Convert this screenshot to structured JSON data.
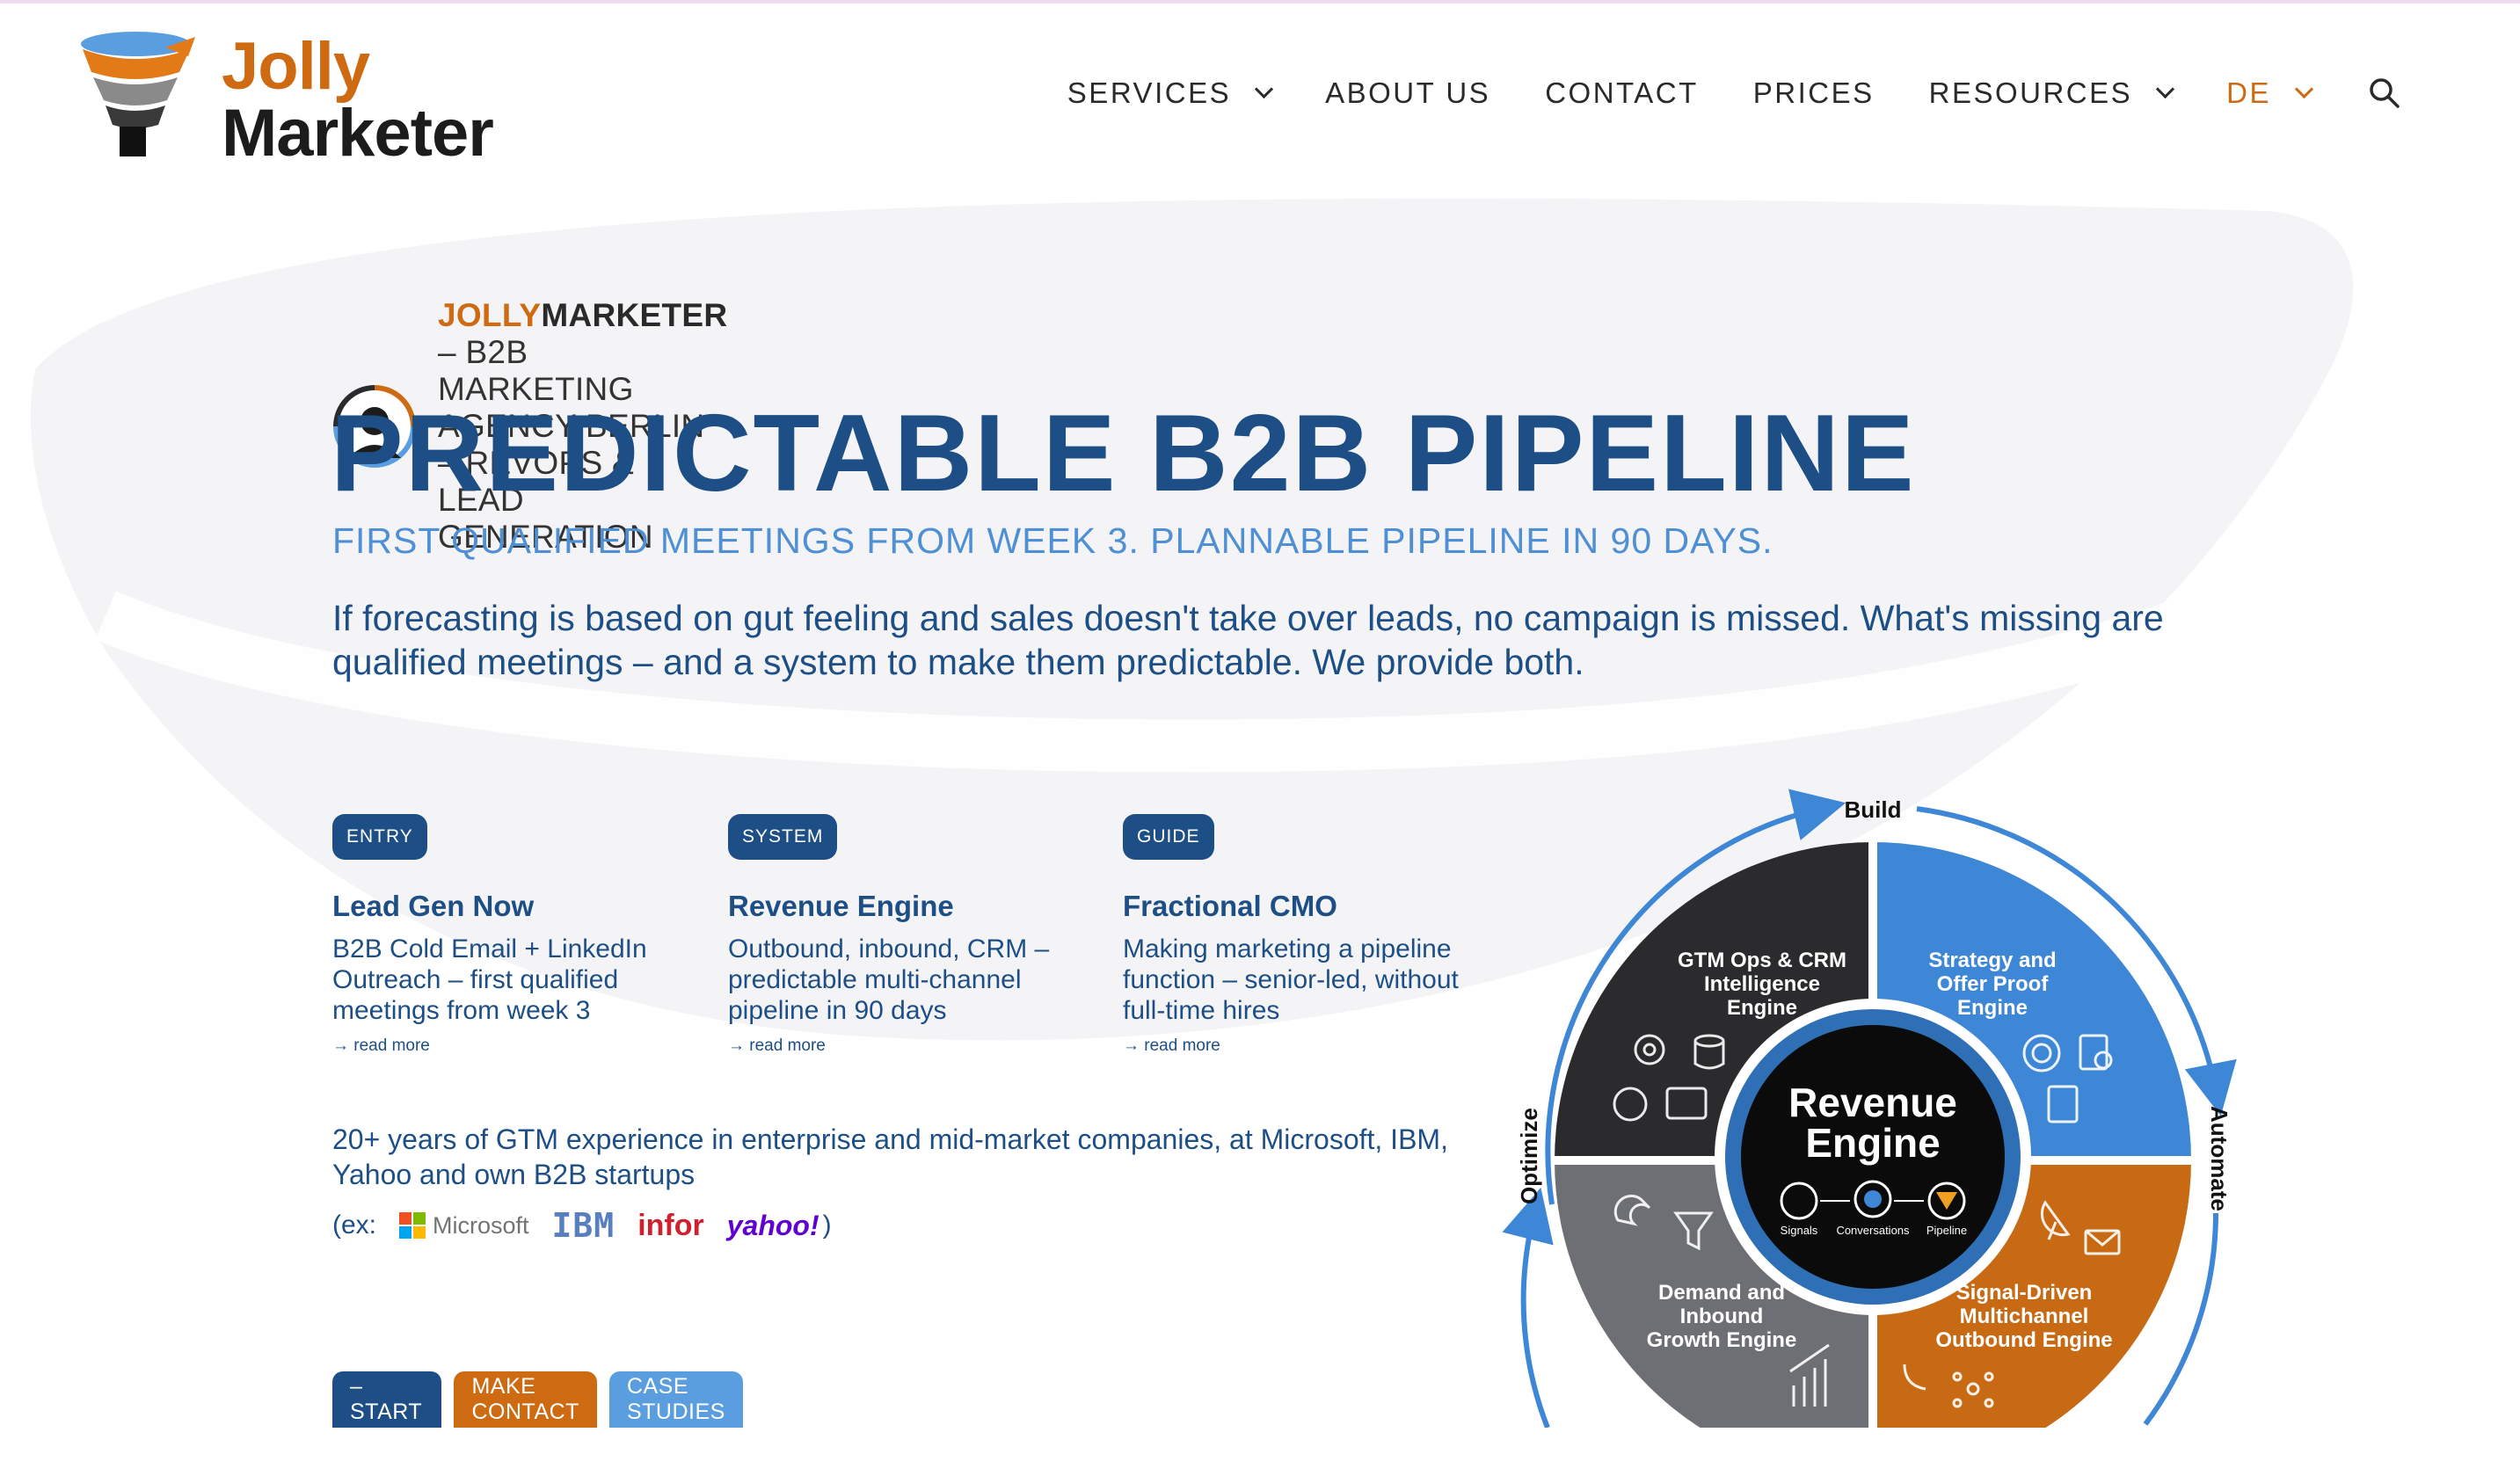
{
  "brand": {
    "logo_line1": "Jolly",
    "logo_line2": "Marketer",
    "accent_orange": "#cd6a12",
    "accent_blue": "#1d4f86",
    "light_blue": "#5b9ee0"
  },
  "nav": {
    "items": [
      {
        "label": "SERVICES",
        "has_dropdown": true
      },
      {
        "label": "ABOUT US",
        "has_dropdown": false
      },
      {
        "label": "CONTACT",
        "has_dropdown": false
      },
      {
        "label": "PRICES",
        "has_dropdown": false
      },
      {
        "label": "RESOURCES",
        "has_dropdown": true
      }
    ],
    "language": "DE",
    "search_icon": "search-icon"
  },
  "hero": {
    "tagline_jolly": "JOLLY",
    "tagline_marketer": "MARKETER",
    "tagline_rest": " – B2B MARKETING AGENCY BERLIN – REVOPS & LEAD GENERATION",
    "title": "PREDICTABLE B2B PIPELINE",
    "subtitle": "FIRST QUALIFIED MEETINGS FROM WEEK 3. PLANNABLE PIPELINE IN 90 DAYS.",
    "lead": "If forecasting is based on gut feeling and sales doesn't take over leads, no campaign is missed. What's missing are qualified meetings – and a system to make them predictable. We provide both."
  },
  "offers": [
    {
      "badge": "ENTRY",
      "title": "Lead Gen Now",
      "desc": "B2B Cold Email + LinkedIn Outreach – first qualified meetings from week 3",
      "more": "→ read more"
    },
    {
      "badge": "SYSTEM",
      "title": "Revenue Engine",
      "desc": "Outbound, inbound, CRM – predictable multi-channel pipeline in 90 days",
      "more": "→ read more"
    },
    {
      "badge": "GUIDE",
      "title": "Fractional CMO",
      "desc": "Making marketing a pipeline function – senior-led, without full-time hires",
      "more": "→ read more"
    }
  ],
  "experience": {
    "text": "20+ years of GTM experience in enterprise and mid-market companies, at Microsoft, IBM, Yahoo and own B2B startups",
    "prefix": "(ex:",
    "suffix": ")",
    "logos": {
      "microsoft": "Microsoft",
      "ibm": "IBM",
      "infor": "infor",
      "yahoo": "yahoo!"
    }
  },
  "buttons": {
    "primary": "MORE LEADS – START NOW →",
    "contact": "MAKE CONTACT",
    "cases": "CASE STUDIES"
  },
  "diagram": {
    "center_line1": "Revenue",
    "center_line2": "Engine",
    "flow": [
      "Signals",
      "Conversations",
      "Pipeline"
    ],
    "cycle": {
      "top": "Build",
      "right": "Automate",
      "left": "Optimize"
    },
    "quadrants": {
      "top_left": [
        "GTM Ops & CRM",
        "Intelligence",
        "Engine"
      ],
      "top_right": [
        "Strategy and",
        "Offer Proof",
        "Engine"
      ],
      "bottom_left": [
        "Demand and",
        "Inbound",
        "Growth Engine"
      ],
      "bottom_right": [
        "Signal-Driven",
        "Multichannel",
        "Outbound Engine"
      ]
    },
    "colors": {
      "dark": "#2b2b2e",
      "blue": "#3e86d6",
      "gray": "#6e6f74",
      "orange": "#c86a14"
    }
  }
}
